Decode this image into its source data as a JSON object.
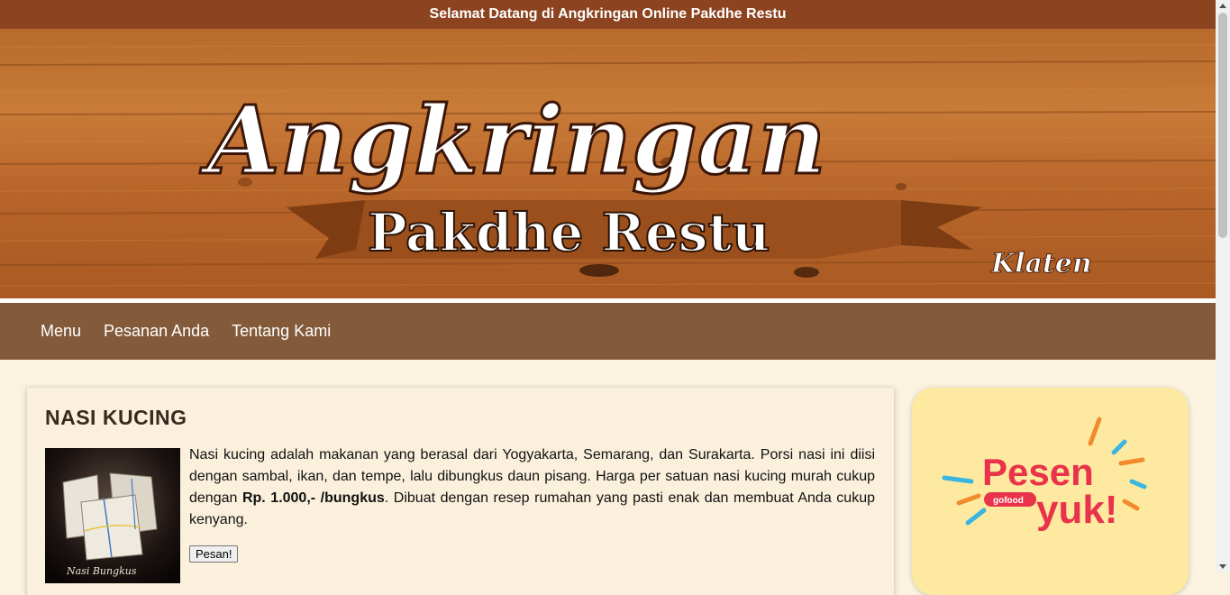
{
  "header": {
    "welcome_text": "Selamat Datang di Angkringan Online Pakdhe Restu"
  },
  "banner": {
    "title": "Angkringan",
    "subtitle": "Pakdhe Restu",
    "city": "Klaten"
  },
  "nav": {
    "items": [
      {
        "label": "Menu"
      },
      {
        "label": "Pesanan Anda"
      },
      {
        "label": "Tentang Kami"
      }
    ]
  },
  "product": {
    "title": "NASI KUCING",
    "image_caption": "Nasi Bungkus",
    "desc_part1": "Nasi kucing adalah makanan yang berasal dari Yogyakarta, Semarang, dan Surakarta. Porsi nasi ini diisi dengan sambal, ikan, dan tempe, lalu dibungkus daun pisang. Harga per satuan nasi kucing murah cukup dengan ",
    "price": "Rp. 1.000,- /bungkus",
    "desc_part2": ". Dibuat dengan resep rumahan yang pasti enak dan membuat Anda cukup kenyang.",
    "button_label": "Pesan!"
  },
  "promo": {
    "line1": "Pesen",
    "line2": "yuk!",
    "brand": "gofood"
  },
  "colors": {
    "topbar": "#8c4420",
    "nav": "#845b3a",
    "page_bg": "#fbf3df",
    "promo_bg": "#fdeaa0",
    "promo_red": "#e8334a"
  }
}
